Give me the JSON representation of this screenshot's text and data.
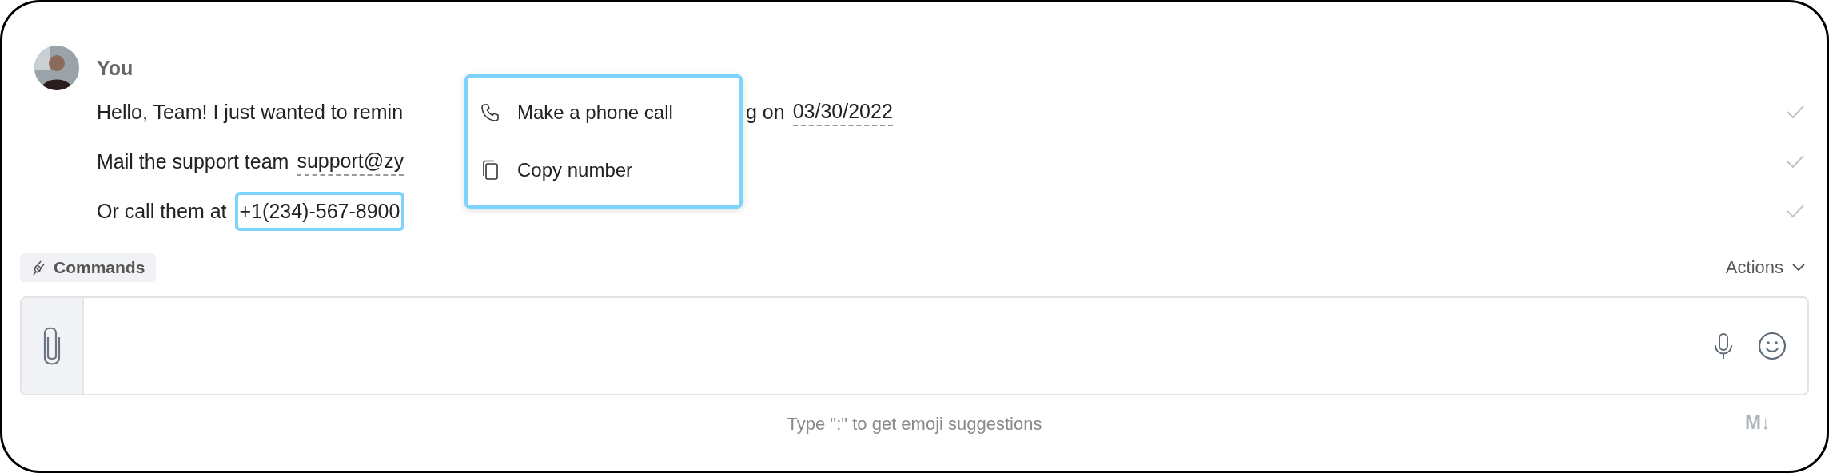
{
  "author": {
    "name": "You"
  },
  "messages": [
    {
      "before": "Hello, Team! I just wanted to remin",
      "after": "g on",
      "link": {
        "text": "03/30/2022"
      },
      "highlighted": false,
      "delivered": true
    },
    {
      "before": "Mail the support team",
      "link": {
        "text": "support@zy"
      },
      "highlighted": false,
      "delivered": true
    },
    {
      "before": "Or call them at",
      "link": {
        "text": "+1(234)-567-8900"
      },
      "highlighted": true,
      "delivered": true
    }
  ],
  "context_menu": {
    "items": [
      {
        "label": "Make a phone call",
        "kind": "call"
      },
      {
        "label": "Copy number",
        "kind": "copy"
      }
    ]
  },
  "commands_button": {
    "label": "Commands"
  },
  "actions_menu": {
    "label": "Actions"
  },
  "composer": {
    "hint": "Type \":\" to get emoji suggestions",
    "markdown_badge": "M↓"
  }
}
